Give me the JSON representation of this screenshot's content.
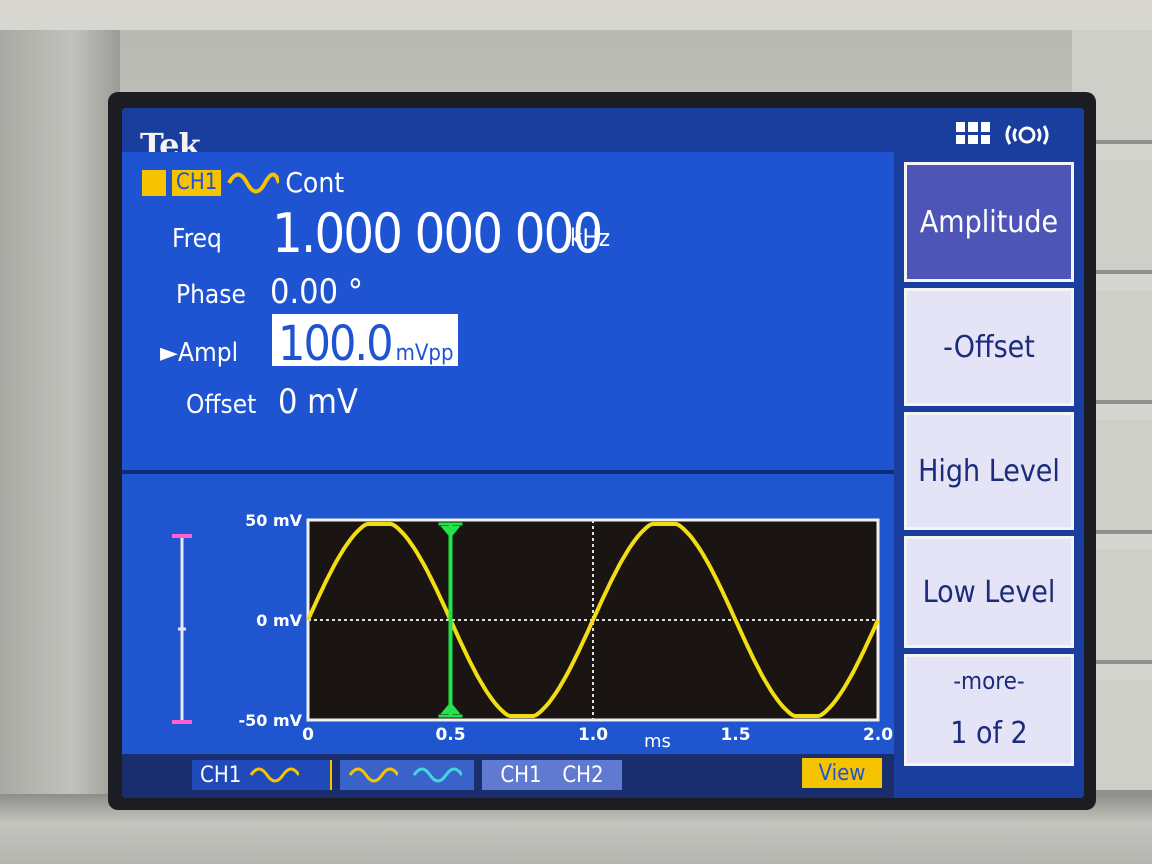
{
  "brand": "Tek",
  "channel": {
    "tag": "CH1",
    "mode": "Cont",
    "waveform_icon": "sine-wave-icon"
  },
  "params": {
    "freq_label": "Freq",
    "freq_value": "1.000 000 000",
    "freq_unit": "kHz",
    "phase_label": "Phase",
    "phase_value": "0.00 °",
    "ampl_label": "►Ampl",
    "ampl_value": "100.0",
    "ampl_unit": "mVpp",
    "offset_label": "Offset",
    "offset_value": "0 mV"
  },
  "softkeys": {
    "amplitude": "Amplitude",
    "offset": "-Offset",
    "high_level": "High Level",
    "low_level": "Low Level",
    "more": "-more-",
    "page": "1 of 2"
  },
  "plot": {
    "y_labels": [
      "50 mV",
      "0 mV",
      "-50 mV"
    ],
    "x_labels": [
      "0",
      "0.5",
      "1.0",
      "1.5",
      "2.0"
    ],
    "x_unit": "ms"
  },
  "bottom": {
    "ch1_tab": "CH1",
    "ch1_label": "CH1",
    "ch2_label": "CH2",
    "view": "View"
  },
  "chart_data": {
    "type": "line",
    "title": "",
    "xlabel": "ms",
    "ylabel": "",
    "xlim": [
      0,
      2.0
    ],
    "ylim": [
      -50,
      50
    ],
    "x_ticks": [
      0,
      0.5,
      1.0,
      1.5,
      2.0
    ],
    "y_ticks": [
      -50,
      0,
      50
    ],
    "series": [
      {
        "frequency_khz": 1.0,
        "amplitude_mv": 50,
        "offset_mv": 0,
        "color": "#f2dc12"
      }
    ],
    "cursor_x": 0.5,
    "grid": true
  },
  "colors": {
    "accent": "#f5c300",
    "screen_bg": "#1e53d2",
    "trace": "#f2dc12",
    "cursor": "#22e34a"
  }
}
